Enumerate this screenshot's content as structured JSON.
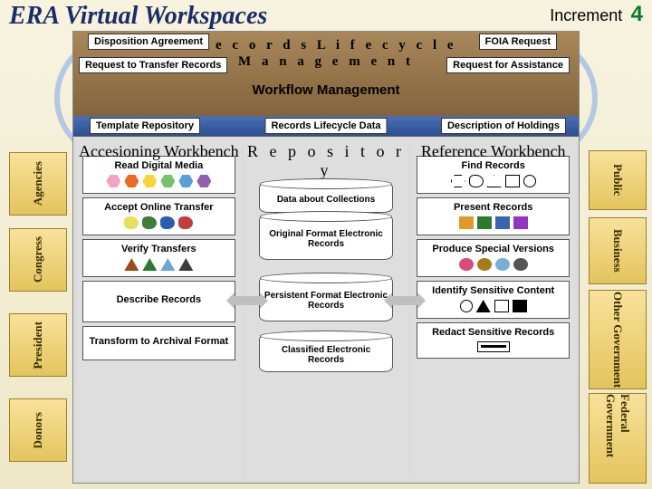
{
  "app_title": "ERA Virtual Workspaces",
  "increment_label": "Increment",
  "increment_value": "4",
  "top_section": {
    "title_line1": "R e c o r d s   L i f e c y c l e",
    "title_line2": "M a n a g e m e n t",
    "workflow_label": "Workflow Management",
    "buttons": {
      "disposition": "Disposition Agreement",
      "foia": "FOIA Request",
      "rtt": "Request to Transfer Records",
      "rfa": "Request for Assistance",
      "template_repo": "Template Repository",
      "rld": "Records Lifecycle Data",
      "doh": "Description of Holdings"
    }
  },
  "columns": {
    "left_title": "Accesioning Workbench",
    "center_title": "R e p o s i t o r y",
    "right_title": "Reference Workbench"
  },
  "left_cards": {
    "read_media": "Read Digital Media",
    "accept_transfer": "Accept Online Transfer",
    "verify": "Verify Transfers",
    "describe": "Describe Records",
    "transform": "Transform to Archival Format"
  },
  "center_dbs": {
    "data_collections": "Data about Collections",
    "original": "Original Format Electronic Records",
    "persistent": "Persistent Format Electronic Records",
    "classified": "Classified Electronic Records"
  },
  "right_cards": {
    "find": "Find Records",
    "present": "Present Records",
    "produce": "Produce Special Versions",
    "identify": "Identify Sensitive Content",
    "redact": "Redact Sensitive Records"
  },
  "left_tabs": [
    "Agencies",
    "Congress",
    "President",
    "Donors"
  ],
  "right_tabs": [
    "Public",
    "Business",
    "Other Government",
    "Federal Government"
  ],
  "colors": {
    "hex_set": [
      "#f2a3c4",
      "#ec6a20",
      "#f4d53a",
      "#72c36a",
      "#5aa0d8",
      "#915fae"
    ],
    "blob_set": [
      "#e7e15a",
      "#3f7d3a",
      "#2a5db0",
      "#c23d3d"
    ],
    "tri_set": [
      "#9a4d17",
      "#257c2f",
      "#6aa7d6",
      "#3b3b3b"
    ],
    "square_set": [
      "#e1992a",
      "#2c7a2c",
      "#3a63b0",
      "#9434c2"
    ],
    "diamond_set": [
      "#d3326a",
      "#3daa3d",
      "#4463c7",
      "#2b2b2b"
    ],
    "circle_set": [
      "#d94b7c",
      "#a67c1a",
      "#7aaed4",
      "#555"
    ]
  }
}
